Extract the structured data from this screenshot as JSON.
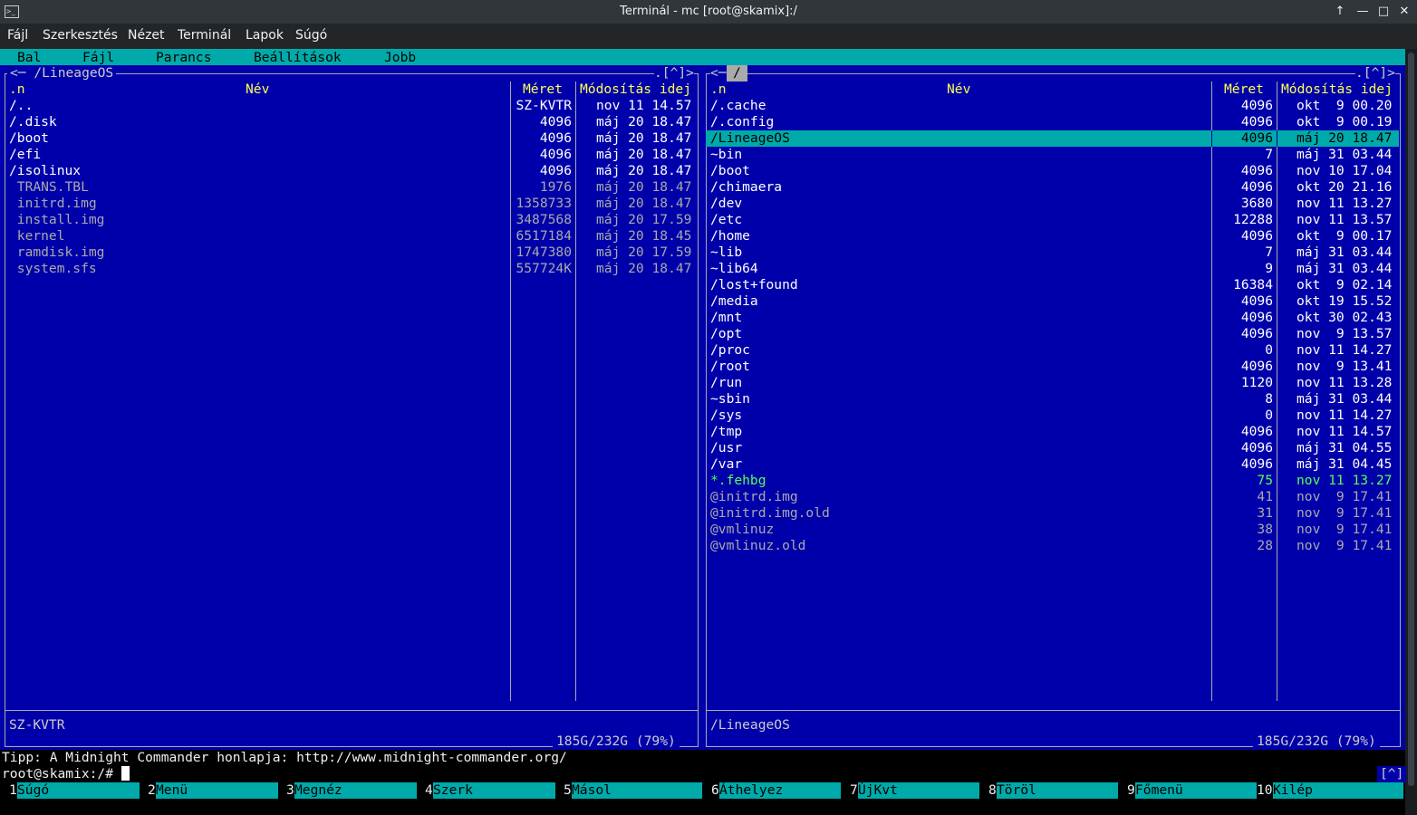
{
  "window": {
    "title": "Terminál - mc [root@skamix]:/",
    "controls": [
      "↑",
      "—",
      "□",
      "✕"
    ]
  },
  "konsole_menu": [
    "Fájl",
    "Szerkesztés",
    "Nézet",
    "Terminál",
    "Lapok",
    "Súgó"
  ],
  "mc_menu": [
    "Bal",
    "Fájl",
    "Parancs",
    "Beállítások",
    "Jobb"
  ],
  "left_panel": {
    "path": "<─ /LineageOS",
    "corner": ".[^]>",
    "headers": {
      "n": ".n",
      "name": "Név",
      "size": "Méret",
      "mtime": "Módosítás idej"
    },
    "rows": [
      {
        "name": "/..",
        "size": "SZ-KVTR",
        "mtime": "nov 11 14.57",
        "type": "dir"
      },
      {
        "name": "/.disk",
        "size": "4096",
        "mtime": "máj 20 18.47",
        "type": "dir"
      },
      {
        "name": "/boot",
        "size": "4096",
        "mtime": "máj 20 18.47",
        "type": "dir"
      },
      {
        "name": "/efi",
        "size": "4096",
        "mtime": "máj 20 18.47",
        "type": "dir"
      },
      {
        "name": "/isolinux",
        "size": "4096",
        "mtime": "máj 20 18.47",
        "type": "dir"
      },
      {
        "name": " TRANS.TBL",
        "size": "1976",
        "mtime": "máj 20 18.47",
        "type": "file"
      },
      {
        "name": " initrd.img",
        "size": "1358733",
        "mtime": "máj 20 18.47",
        "type": "file"
      },
      {
        "name": " install.img",
        "size": "3487568",
        "mtime": "máj 20 17.59",
        "type": "file"
      },
      {
        "name": " kernel",
        "size": "6517184",
        "mtime": "máj 20 18.45",
        "type": "file"
      },
      {
        "name": " ramdisk.img",
        "size": "1747380",
        "mtime": "máj 20 17.59",
        "type": "file"
      },
      {
        "name": " system.sfs",
        "size": "557724K",
        "mtime": "máj 20 18.47",
        "type": "file"
      }
    ],
    "status": "SZ-KVTR",
    "usage": "185G/232G (79%)"
  },
  "right_panel": {
    "path": "/",
    "corner": ".[^]>",
    "left_corner": "<─",
    "headers": {
      "n": ".n",
      "name": "Név",
      "size": "Méret",
      "mtime": "Módosítás idej"
    },
    "rows": [
      {
        "name": "/.cache",
        "size": "4096",
        "mtime": "okt  9 00.20",
        "type": "dir"
      },
      {
        "name": "/.config",
        "size": "4096",
        "mtime": "okt  9 00.19",
        "type": "dir"
      },
      {
        "name": "/LineageOS",
        "size": "4096",
        "mtime": "máj 20 18.47",
        "type": "sel"
      },
      {
        "name": "~bin",
        "size": "7",
        "mtime": "máj 31 03.44",
        "type": "dir"
      },
      {
        "name": "/boot",
        "size": "4096",
        "mtime": "nov 10 17.04",
        "type": "dir"
      },
      {
        "name": "/chimaera",
        "size": "4096",
        "mtime": "okt 20 21.16",
        "type": "dir"
      },
      {
        "name": "/dev",
        "size": "3680",
        "mtime": "nov 11 13.27",
        "type": "dir"
      },
      {
        "name": "/etc",
        "size": "12288",
        "mtime": "nov 11 13.57",
        "type": "dir"
      },
      {
        "name": "/home",
        "size": "4096",
        "mtime": "okt  9 00.17",
        "type": "dir"
      },
      {
        "name": "~lib",
        "size": "7",
        "mtime": "máj 31 03.44",
        "type": "dir"
      },
      {
        "name": "~lib64",
        "size": "9",
        "mtime": "máj 31 03.44",
        "type": "dir"
      },
      {
        "name": "/lost+found",
        "size": "16384",
        "mtime": "okt  9 02.14",
        "type": "dir"
      },
      {
        "name": "/media",
        "size": "4096",
        "mtime": "okt 19 15.52",
        "type": "dir"
      },
      {
        "name": "/mnt",
        "size": "4096",
        "mtime": "okt 30 02.43",
        "type": "dir"
      },
      {
        "name": "/opt",
        "size": "4096",
        "mtime": "nov  9 13.57",
        "type": "dir"
      },
      {
        "name": "/proc",
        "size": "0",
        "mtime": "nov 11 14.27",
        "type": "dir"
      },
      {
        "name": "/root",
        "size": "4096",
        "mtime": "nov  9 13.41",
        "type": "dir"
      },
      {
        "name": "/run",
        "size": "1120",
        "mtime": "nov 11 13.28",
        "type": "dir"
      },
      {
        "name": "~sbin",
        "size": "8",
        "mtime": "máj 31 03.44",
        "type": "dir"
      },
      {
        "name": "/sys",
        "size": "0",
        "mtime": "nov 11 14.27",
        "type": "dir"
      },
      {
        "name": "/tmp",
        "size": "4096",
        "mtime": "nov 11 14.57",
        "type": "dir"
      },
      {
        "name": "/usr",
        "size": "4096",
        "mtime": "máj 31 04.55",
        "type": "dir"
      },
      {
        "name": "/var",
        "size": "4096",
        "mtime": "máj 31 04.45",
        "type": "dir"
      },
      {
        "name": "*.fehbg",
        "size": "75",
        "mtime": "nov 11 13.27",
        "type": "exec"
      },
      {
        "name": "@initrd.img",
        "size": "41",
        "mtime": "nov  9 17.41",
        "type": "file"
      },
      {
        "name": "@initrd.img.old",
        "size": "31",
        "mtime": "nov  9 17.41",
        "type": "file"
      },
      {
        "name": "@vmlinuz",
        "size": "38",
        "mtime": "nov  9 17.41",
        "type": "file"
      },
      {
        "name": "@vmlinuz.old",
        "size": "28",
        "mtime": "nov  9 17.41",
        "type": "file"
      }
    ],
    "status": "/LineageOS",
    "usage": "185G/232G (79%)"
  },
  "tip": "Tipp: A Midnight Commander honlapja: http://www.midnight-commander.org/",
  "prompt": "root@skamix:/# ",
  "history_button": "[^]",
  "fkeys": [
    {
      "num": "1",
      "label": "Súgó"
    },
    {
      "num": "2",
      "label": "Menü"
    },
    {
      "num": "3",
      "label": "Megnéz"
    },
    {
      "num": "4",
      "label": "Szerk"
    },
    {
      "num": "5",
      "label": "Másol"
    },
    {
      "num": "6",
      "label": "Áthelyez"
    },
    {
      "num": "7",
      "label": "ÚjKvt"
    },
    {
      "num": "8",
      "label": "Töröl"
    },
    {
      "num": "9",
      "label": "Főmenü"
    },
    {
      "num": "10",
      "label": "Kilép"
    }
  ],
  "colors": {
    "panel_bg": "#0000aa",
    "accent": "#00aaaa",
    "header": "#ffff55",
    "exec": "#55ff55"
  }
}
